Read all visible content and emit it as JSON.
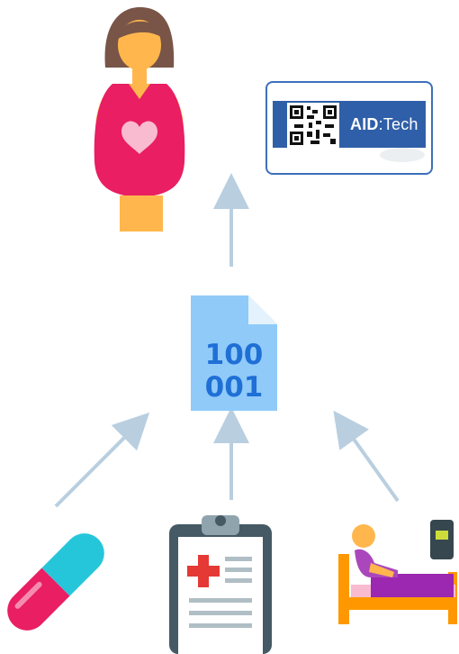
{
  "nodes": {
    "pregnant_woman": {
      "icon": "pregnant-woman-icon"
    },
    "id_card": {
      "icon": "qr-code-icon",
      "brand_prefix": "AID",
      "brand_suffix": ":Tech",
      "brand_color": "#2f5fa8"
    },
    "data_file": {
      "icon": "binary-file-icon",
      "line1": "100",
      "line2": "001",
      "file_color": "#90caf9",
      "text_color": "#1f6fd6"
    },
    "medicine": {
      "icon": "capsule-icon"
    },
    "medical_record": {
      "icon": "clipboard-medical-icon"
    },
    "hospital_bed": {
      "icon": "hospital-bed-icon"
    }
  },
  "colors": {
    "arrow": "#b9cfe0",
    "dress": "#e91e63",
    "skin": "#ffb74d",
    "hair": "#795548",
    "heart": "#f8bbd0"
  }
}
